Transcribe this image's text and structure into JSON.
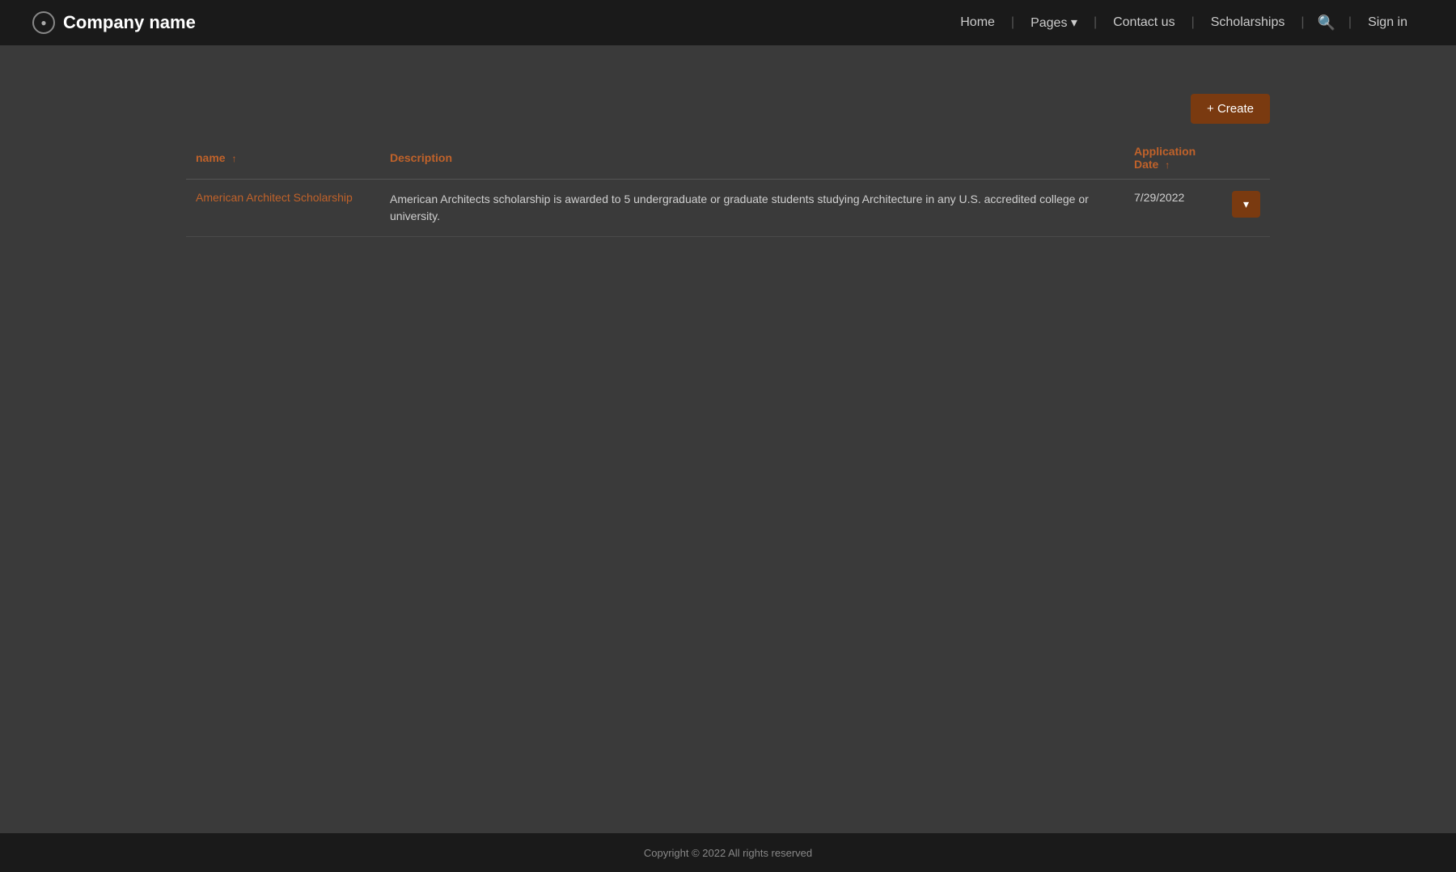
{
  "brand": {
    "icon_label": "●",
    "name": "Company name"
  },
  "nav": {
    "home": "Home",
    "pages": "Pages",
    "pages_dropdown_icon": "▾",
    "contact_us": "Contact us",
    "scholarships": "Scholarships",
    "sign_in": "Sign in"
  },
  "table": {
    "create_button_label": "+ Create",
    "columns": [
      {
        "label": "name",
        "sort_icon": "↑"
      },
      {
        "label": "Description",
        "sort_icon": ""
      },
      {
        "label": "Application Date",
        "sort_icon": "↑"
      }
    ],
    "rows": [
      {
        "name": "American Architect Scholarship",
        "description": "American Architects scholarship is awarded to 5 undergraduate or graduate students studying Architecture in any U.S. accredited college or university.",
        "application_date": "7/29/2022"
      }
    ]
  },
  "footer": {
    "copyright": "Copyright © 2022  All rights reserved"
  }
}
